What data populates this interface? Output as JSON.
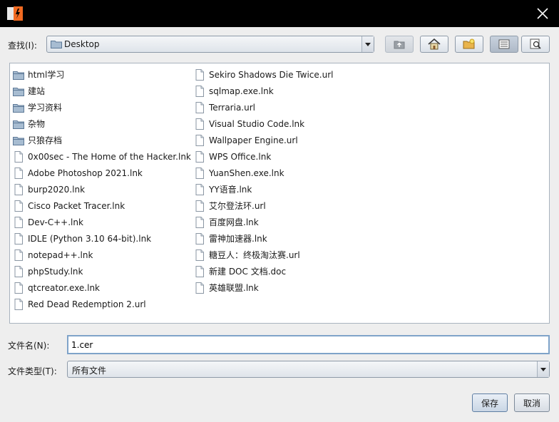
{
  "dialog": {
    "look_in_label": "查找(I):",
    "look_in_value": "Desktop",
    "file_name_label": "文件名(N):",
    "file_name_value": "1.cer",
    "file_type_label": "文件类型(T):",
    "file_type_value": "所有文件",
    "save_label": "保存",
    "cancel_label": "取消"
  },
  "files_col1": [
    {
      "name": "html学习",
      "type": "folder"
    },
    {
      "name": "建站",
      "type": "folder"
    },
    {
      "name": "学习资料",
      "type": "folder"
    },
    {
      "name": "杂物",
      "type": "folder"
    },
    {
      "name": "只狼存档",
      "type": "folder"
    },
    {
      "name": "0x00sec - The Home of the Hacker.lnk",
      "type": "file"
    },
    {
      "name": "Adobe Photoshop 2021.lnk",
      "type": "file"
    },
    {
      "name": "burp2020.lnk",
      "type": "file"
    },
    {
      "name": "Cisco Packet Tracer.lnk",
      "type": "file"
    },
    {
      "name": "Dev-C++.lnk",
      "type": "file"
    },
    {
      "name": "IDLE (Python 3.10 64-bit).lnk",
      "type": "file"
    },
    {
      "name": "notepad++.lnk",
      "type": "file"
    },
    {
      "name": "phpStudy.lnk",
      "type": "file"
    },
    {
      "name": "qtcreator.exe.lnk",
      "type": "file"
    },
    {
      "name": "Red Dead Redemption 2.url",
      "type": "file"
    }
  ],
  "files_col2": [
    {
      "name": "Sekiro Shadows Die Twice.url",
      "type": "file"
    },
    {
      "name": "sqlmap.exe.lnk",
      "type": "file"
    },
    {
      "name": "Terraria.url",
      "type": "file"
    },
    {
      "name": "Visual Studio Code.lnk",
      "type": "file"
    },
    {
      "name": "Wallpaper Engine.url",
      "type": "file"
    },
    {
      "name": "WPS Office.lnk",
      "type": "file"
    },
    {
      "name": "YuanShen.exe.lnk",
      "type": "file"
    },
    {
      "name": "YY语音.lnk",
      "type": "file"
    },
    {
      "name": "艾尔登法环.url",
      "type": "file"
    },
    {
      "name": "百度网盘.lnk",
      "type": "file"
    },
    {
      "name": "雷神加速器.lnk",
      "type": "file"
    },
    {
      "name": "糖豆人：终极淘汰赛.url",
      "type": "file"
    },
    {
      "name": "新建 DOC 文档.doc",
      "type": "file"
    },
    {
      "name": "英雄联盟.lnk",
      "type": "file"
    }
  ],
  "toolbar_icons": [
    "up-folder-icon",
    "home-icon",
    "new-folder-icon",
    "list-view-icon",
    "details-view-icon"
  ],
  "colors": {
    "titlebar": "#000000",
    "accent": "#7fa3c9",
    "folder": "#6f8fb0"
  }
}
